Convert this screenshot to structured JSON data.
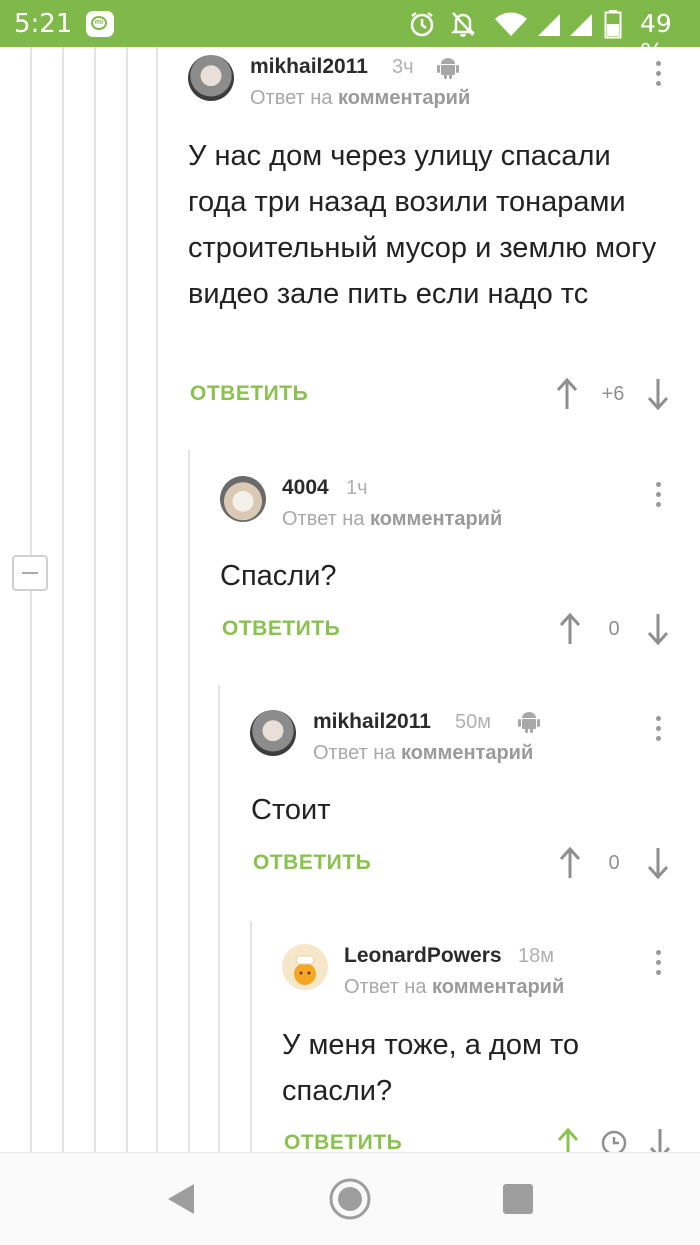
{
  "status_bar": {
    "time": "5:21",
    "battery": "49 %",
    "icons": [
      "mi-app-icon",
      "alarm-icon",
      "notifications-off-icon",
      "wifi-icon",
      "signal-icon",
      "signal-icon",
      "battery-icon"
    ]
  },
  "thread": {
    "reply_label": "ответить",
    "reply_to_prefix": "Ответ на",
    "reply_to_target": "комментарий",
    "comments": [
      {
        "author": "mikhail2011",
        "time": "3ч",
        "platform_icon": "android-icon",
        "text": "У нас дом через улицу спасали года три назад возили тонарами строительный мусор и землю могу видео зале пить если надо тс",
        "rating": "+6"
      },
      {
        "author": "4004",
        "time": "1ч",
        "text": "Спасли?",
        "rating": "0"
      },
      {
        "author": "mikhail2011",
        "time": "50м",
        "platform_icon": "android-icon",
        "text": "Стоит",
        "rating": "0"
      },
      {
        "author": "LeonardPowers",
        "time": "18м",
        "text": "У меня тоже, а дом то спасли?",
        "rating": ""
      }
    ]
  },
  "colors": {
    "status_bar": "#7fb94a",
    "reply_green": "#8ac250",
    "upvoted_green": "#8ac250"
  }
}
